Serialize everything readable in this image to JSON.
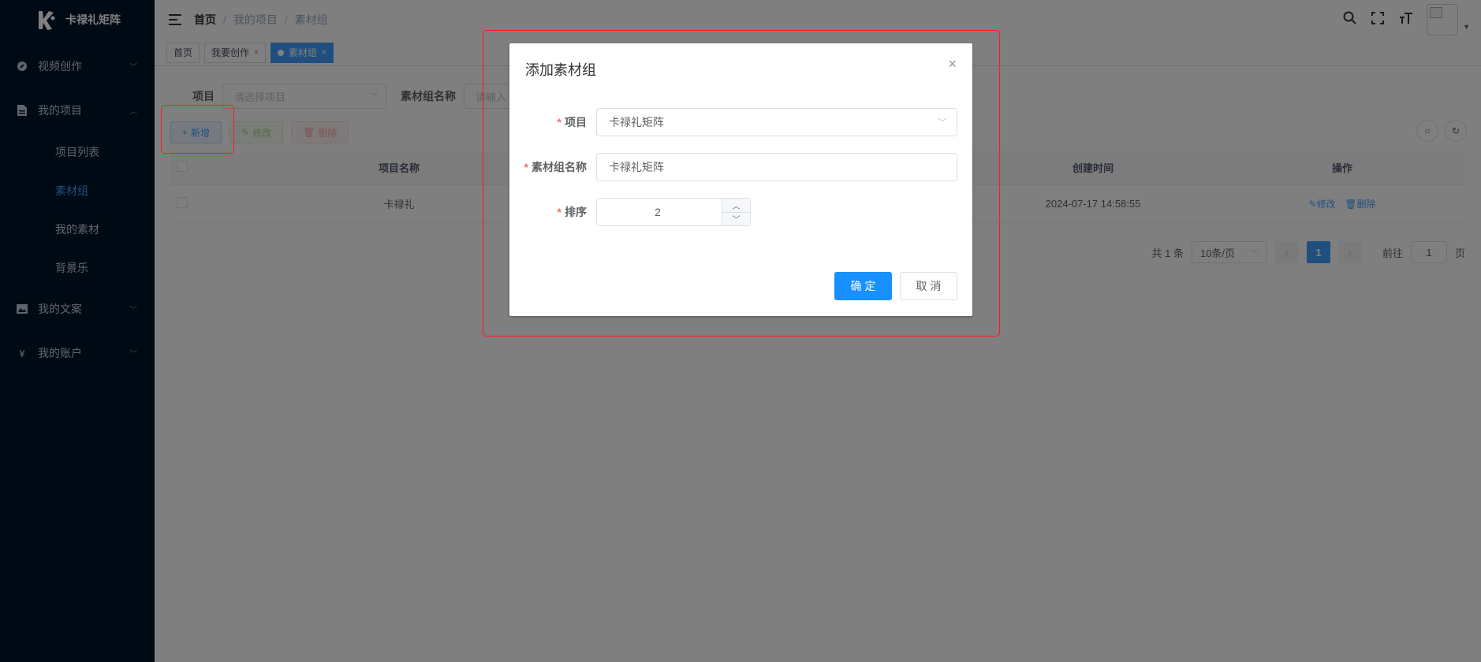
{
  "app": {
    "name": "卡禄礼矩阵"
  },
  "sidebar": {
    "items": [
      {
        "label": "视频创作",
        "icon": "compass-icon",
        "expanded": false
      },
      {
        "label": "我的项目",
        "icon": "document-icon",
        "expanded": true,
        "children": [
          {
            "label": "项目列表"
          },
          {
            "label": "素材组",
            "active": true
          },
          {
            "label": "我的素材"
          },
          {
            "label": "背景乐"
          }
        ]
      },
      {
        "label": "我的文案",
        "icon": "picture-icon",
        "expanded": false
      },
      {
        "label": "我的账户",
        "icon": "yen-icon",
        "expanded": false
      }
    ]
  },
  "navbar": {
    "breadcrumb": [
      "首页",
      "我的项目",
      "素材组"
    ]
  },
  "tags": [
    {
      "label": "首页"
    },
    {
      "label": "我要创作"
    },
    {
      "label": "素材组",
      "active": true
    }
  ],
  "search": {
    "project_label": "项目",
    "project_placeholder": "请选择项目",
    "group_name_label": "素材组名称",
    "group_name_placeholder": "请输入"
  },
  "toolbar": {
    "add_label": "新增",
    "edit_label": "修改",
    "delete_label": "删除"
  },
  "table": {
    "columns": [
      "项目名称",
      "创建时间",
      "操作"
    ],
    "rows": [
      {
        "project_name": "卡禄礼",
        "created_at": "2024-07-17 14:58:55",
        "edit": "修改",
        "delete": "删除"
      }
    ]
  },
  "pagination": {
    "total_text": "共 1 条",
    "page_size": "10条/页",
    "current_page": "1",
    "goto_label": "前往",
    "goto_value": "1",
    "page_suffix": "页"
  },
  "dialog": {
    "title": "添加素材组",
    "fields": {
      "project_label": "项目",
      "project_value": "卡禄礼矩阵",
      "name_label": "素材组名称",
      "name_value": "卡禄礼矩阵",
      "sort_label": "排序",
      "sort_value": "2"
    },
    "confirm_label": "确 定",
    "cancel_label": "取 消"
  },
  "colors": {
    "sidebar_bg": "#001529",
    "primary": "#1890ff",
    "annotation": "#ff1a1a"
  }
}
